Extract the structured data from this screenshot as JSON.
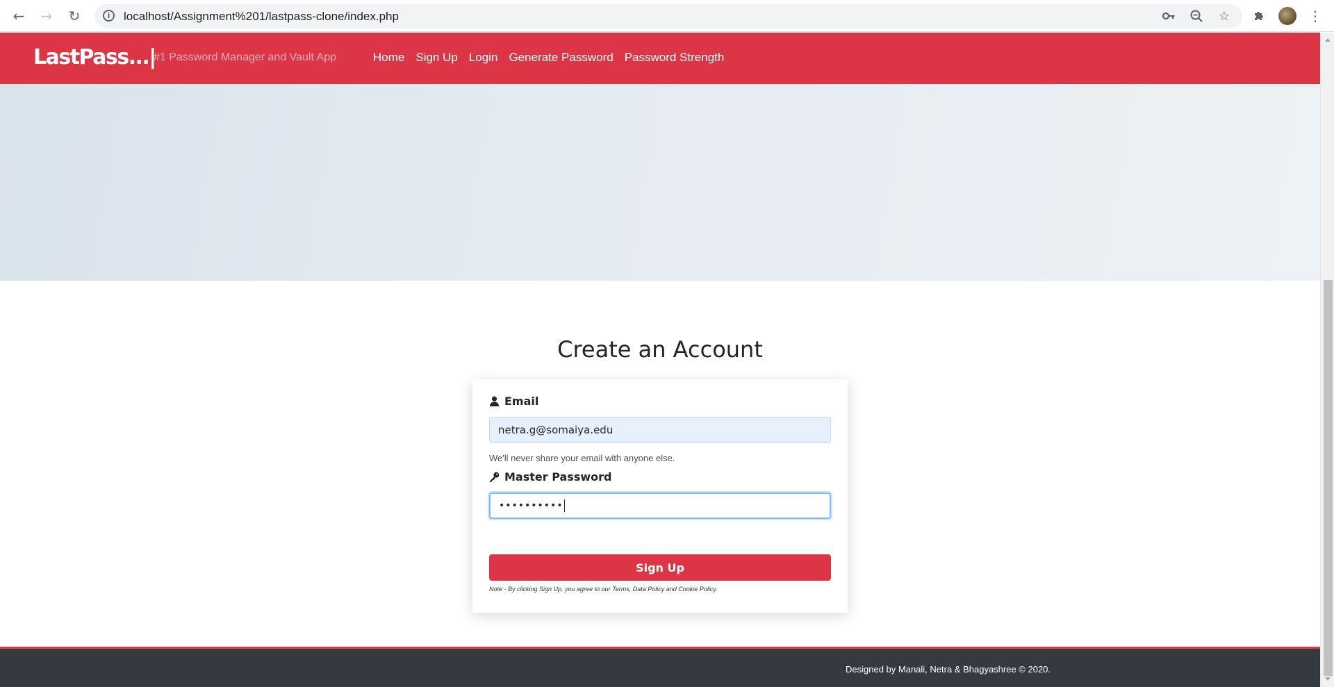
{
  "browser": {
    "url": "localhost/Assignment%201/lastpass-clone/index.php",
    "icons": {
      "back": "arrow-left-icon",
      "forward": "arrow-right-icon",
      "reload": "reload-icon",
      "site_info": "info-icon",
      "key": "key-icon",
      "zoom": "zoom-out-icon",
      "bookmark": "star-icon",
      "extensions": "puzzle-icon",
      "menu": "kebab-menu-icon"
    }
  },
  "navbar": {
    "brand": "LastPass...|",
    "tagline": "#1 Password Manager and Vault App",
    "links": [
      "Home",
      "Sign Up",
      "Login",
      "Generate Password",
      "Password Strength"
    ]
  },
  "form": {
    "heading": "Create an Account",
    "email_label": "Email",
    "email_value": "netra.g@somaiya.edu",
    "email_help": "We'll never share your email with anyone else.",
    "password_label": "Master Password",
    "password_value": "••••••••••",
    "submit_label": "Sign Up",
    "note": "Note - By clicking Sign Up, you agree to our Terms, Data Policy and Cookie Policy."
  },
  "footer": {
    "text": "Designed by Manali, Netra & Bhagyashree © 2020."
  },
  "colors": {
    "brand_red": "#dc3545",
    "footer_dark": "#343a40",
    "autofill_blue": "#e8f0fe",
    "focus_blue": "#80bdff"
  }
}
